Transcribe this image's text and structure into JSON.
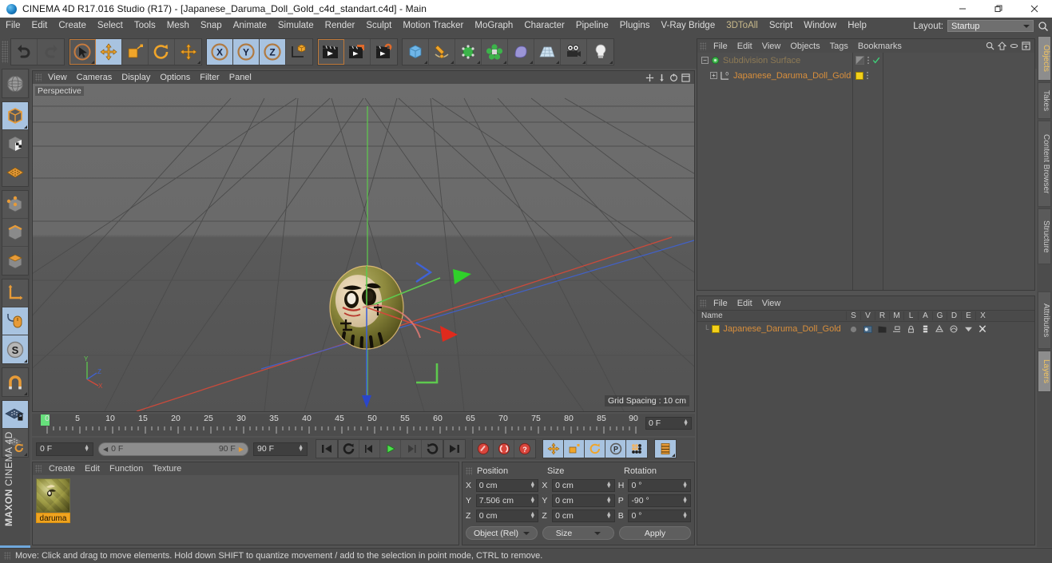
{
  "window": {
    "title": "CINEMA 4D R17.016 Studio (R17) - [Japanese_Daruma_Doll_Gold_c4d_standart.c4d] - Main",
    "app_icon": "cinema4d-logo-icon",
    "minimize": "─",
    "maximize": "❐",
    "close": "×"
  },
  "menubar": {
    "items": [
      {
        "label": "File"
      },
      {
        "label": "Edit"
      },
      {
        "label": "Create"
      },
      {
        "label": "Select"
      },
      {
        "label": "Tools"
      },
      {
        "label": "Mesh"
      },
      {
        "label": "Snap"
      },
      {
        "label": "Animate"
      },
      {
        "label": "Simulate"
      },
      {
        "label": "Render"
      },
      {
        "label": "Sculpt"
      },
      {
        "label": "Motion Tracker"
      },
      {
        "label": "MoGraph"
      },
      {
        "label": "Character"
      },
      {
        "label": "Pipeline"
      },
      {
        "label": "Plugins"
      },
      {
        "label": "V-Ray Bridge"
      },
      {
        "label": "3DToAll"
      },
      {
        "label": "Script"
      },
      {
        "label": "Window"
      },
      {
        "label": "Help"
      }
    ],
    "layout_label": "Layout:",
    "layout_value": "Startup",
    "search_icon": "magnifier-icon"
  },
  "toolbar": {
    "groups": [
      {
        "buttons": [
          {
            "name": "undo-button",
            "icon": "undo-arrow-icon",
            "state": "normal"
          },
          {
            "name": "redo-button",
            "icon": "redo-arrow-icon",
            "state": "disabled"
          }
        ]
      },
      {
        "buttons": [
          {
            "name": "live-selection-tool",
            "icon": "arrow-cursor-circle-icon",
            "state": "outlined"
          },
          {
            "name": "move-tool",
            "icon": "move-cross-arrows-icon",
            "state": "active"
          },
          {
            "name": "scale-tool",
            "icon": "scale-box-icon",
            "state": "normal"
          },
          {
            "name": "rotate-tool",
            "icon": "rotate-circle-arrow-icon",
            "state": "normal"
          },
          {
            "name": "move-axis-tool",
            "icon": "move-cross-arrows-icon",
            "state": "normal"
          }
        ]
      },
      {
        "buttons": [
          {
            "name": "x-axis-lock-button",
            "icon": "x-axis-icon",
            "state": "active",
            "label": "X"
          },
          {
            "name": "y-axis-lock-button",
            "icon": "y-axis-icon",
            "state": "active",
            "label": "Y"
          },
          {
            "name": "z-axis-lock-button",
            "icon": "z-axis-icon",
            "state": "active",
            "label": "Z"
          },
          {
            "name": "world-object-coordinate-button",
            "icon": "world-axis-cube-icon",
            "state": "normal"
          }
        ]
      },
      {
        "buttons": [
          {
            "name": "render-view-button",
            "icon": "clapperboard-icon",
            "state": "outlined"
          },
          {
            "name": "render-to-picture-viewer-button",
            "icon": "clapperboard-picture-icon",
            "state": "normal"
          },
          {
            "name": "render-settings-button",
            "icon": "clapperboard-gear-icon",
            "state": "normal"
          }
        ]
      },
      {
        "buttons": [
          {
            "name": "add-cube-object-button",
            "icon": "blue-cube-icon",
            "state": "normal"
          },
          {
            "name": "add-spline-button",
            "icon": "pen-spline-icon",
            "state": "normal"
          },
          {
            "name": "add-generator-button",
            "icon": "green-cube-icon",
            "state": "normal"
          },
          {
            "name": "add-array-button",
            "icon": "green-cluster-icon",
            "state": "normal"
          },
          {
            "name": "add-deformer-button",
            "icon": "purple-bend-icon",
            "state": "normal"
          },
          {
            "name": "add-scene-environment-button",
            "icon": "floor-grid-icon",
            "state": "normal"
          },
          {
            "name": "add-camera-button",
            "icon": "camera-icon",
            "state": "normal"
          },
          {
            "name": "add-light-button",
            "icon": "lightbulb-icon",
            "state": "normal"
          }
        ]
      }
    ]
  },
  "leftbar": {
    "groups": [
      {
        "buttons": [
          {
            "name": "make-editable-button",
            "icon": "sphere-wireframe-icon",
            "state": "normal"
          }
        ]
      },
      {
        "buttons": [
          {
            "name": "model-mode-button",
            "icon": "orange-outline-cube-icon",
            "state": "active"
          },
          {
            "name": "texture-mode-button",
            "icon": "checker-cube-icon",
            "state": "normal"
          },
          {
            "name": "workplane-mode-button",
            "icon": "orange-grid-plane-icon",
            "state": "normal"
          }
        ]
      },
      {
        "buttons": [
          {
            "name": "point-mode-button",
            "icon": "cube-points-icon",
            "state": "normal"
          },
          {
            "name": "edge-mode-button",
            "icon": "cube-edge-icon",
            "state": "normal"
          },
          {
            "name": "polygon-mode-button",
            "icon": "cube-polygon-icon",
            "state": "normal"
          }
        ]
      },
      {
        "buttons": [
          {
            "name": "object-axis-mode-button",
            "icon": "axis-corner-icon",
            "state": "normal"
          },
          {
            "name": "enable-axis-modification-button",
            "icon": "mouse-axis-icon",
            "state": "active"
          },
          {
            "name": "soft-selection-button",
            "icon": "s-circle-icon",
            "state": "active"
          }
        ]
      },
      {
        "buttons": [
          {
            "name": "enable-snapping-button",
            "icon": "magnet-icon",
            "state": "normal"
          }
        ]
      },
      {
        "buttons": [
          {
            "name": "lock-workplane-button",
            "icon": "grid-lock-icon",
            "state": "active"
          },
          {
            "name": "planar-workplane-button",
            "icon": "grid-rotate-icon",
            "state": "normal"
          }
        ]
      }
    ],
    "brand_line1": "MAXON",
    "brand_line2": "CINEMA 4D"
  },
  "viewport": {
    "menus": [
      {
        "label": "View"
      },
      {
        "label": "Cameras"
      },
      {
        "label": "Display"
      },
      {
        "label": "Options"
      },
      {
        "label": "Filter"
      },
      {
        "label": "Panel"
      }
    ],
    "corner_icons": [
      "pan-icon",
      "dolly-icon",
      "orbit-icon",
      "maximize-view-icon"
    ],
    "label": "Perspective",
    "grid_spacing": "Grid Spacing : 10 cm",
    "mini_axis": [
      "Y",
      "Z",
      "X"
    ],
    "object_name": "Japanese Daruma Doll"
  },
  "timeline": {
    "ticks": [
      "0",
      "5",
      "10",
      "15",
      "20",
      "25",
      "30",
      "35",
      "40",
      "45",
      "50",
      "55",
      "60",
      "65",
      "70",
      "75",
      "80",
      "85",
      "90"
    ],
    "current_frame_field": "0 F",
    "start_frame": "0 F",
    "range_start": "0 F",
    "range_end": "90 F",
    "end_frame": "90 F"
  },
  "transport": {
    "buttons": [
      {
        "name": "go-to-start-button",
        "icon": "skip-start-icon"
      },
      {
        "name": "go-to-previous-key-button",
        "icon": "loop-back-icon"
      },
      {
        "name": "go-back-one-frame-button",
        "icon": "step-back-icon"
      },
      {
        "name": "play-forwards-button",
        "icon": "play-icon"
      },
      {
        "name": "go-forward-one-frame-button",
        "icon": "step-forward-icon"
      },
      {
        "name": "go-to-next-key-button",
        "icon": "loop-forward-icon"
      },
      {
        "name": "go-to-end-button",
        "icon": "skip-end-icon"
      },
      {
        "name": "record-active-objects-button",
        "icon": "record-key-icon"
      },
      {
        "name": "autokeying-button",
        "icon": "autokey-icon"
      },
      {
        "name": "keyframe-selection-button",
        "icon": "question-key-icon"
      },
      {
        "name": "position-key-button",
        "icon": "position-key-icon",
        "state": "active"
      },
      {
        "name": "scale-key-button",
        "icon": "scale-key-icon",
        "state": "active"
      },
      {
        "name": "rotation-key-button",
        "icon": "rotation-key-icon",
        "state": "active"
      },
      {
        "name": "parameter-key-button",
        "icon": "p-key-icon",
        "state": "active"
      },
      {
        "name": "point-level-animation-button",
        "icon": "pla-dots-icon",
        "state": "active"
      },
      {
        "name": "timeline-toggle-button",
        "icon": "timeline-strip-icon",
        "state": "active"
      }
    ]
  },
  "material_manager": {
    "menus": [
      {
        "label": "Create"
      },
      {
        "label": "Edit"
      },
      {
        "label": "Function"
      },
      {
        "label": "Texture"
      }
    ],
    "materials": [
      {
        "name": "daruma",
        "swatch": "gold-sphere-preview"
      }
    ]
  },
  "coordinates": {
    "headers": [
      "Position",
      "Size",
      "Rotation"
    ],
    "rows": [
      {
        "pos_axis": "X",
        "pos_value": "0 cm",
        "size_axis": "X",
        "size_value": "0 cm",
        "rot_axis": "H",
        "rot_value": "0 °"
      },
      {
        "pos_axis": "Y",
        "pos_value": "7.506 cm",
        "size_axis": "Y",
        "size_value": "0 cm",
        "rot_axis": "P",
        "rot_value": "-90 °"
      },
      {
        "pos_axis": "Z",
        "pos_value": "0 cm",
        "size_axis": "Z",
        "size_value": "0 cm",
        "rot_axis": "B",
        "rot_value": "0 °"
      }
    ],
    "mode_dropdown": "Object (Rel)",
    "size_dropdown": "Size",
    "apply_button": "Apply"
  },
  "object_manager": {
    "menus": [
      {
        "label": "File"
      },
      {
        "label": "Edit"
      },
      {
        "label": "View"
      },
      {
        "label": "Objects"
      },
      {
        "label": "Tags"
      },
      {
        "label": "Bookmarks"
      }
    ],
    "tools": [
      "search-icon",
      "home-icon",
      "link-icon",
      "expand-icon"
    ],
    "items": [
      {
        "label": "Subdivision Surface",
        "icon": "subdivision-surface-icon",
        "indent": 0,
        "dimmed": true,
        "tags": [
          "phong-tag-icon",
          "dots-icon",
          "check-icon"
        ]
      },
      {
        "label": "Japanese_Daruma_Doll_Gold",
        "icon": "polygon-object-icon",
        "indent": 1,
        "dimmed": false,
        "tags": [
          "material-tag-yellow",
          "dots-icon"
        ]
      }
    ]
  },
  "attribute_manager": {
    "menus": [
      {
        "label": "File"
      },
      {
        "label": "Edit"
      },
      {
        "label": "View"
      }
    ],
    "name_header": "Name",
    "columns": [
      "S",
      "V",
      "R",
      "M",
      "L",
      "A",
      "G",
      "D",
      "E",
      "X"
    ],
    "rows": [
      {
        "name": "Japanese_Daruma_Doll_Gold",
        "swatch": "yellow-layer-swatch"
      }
    ]
  },
  "right_tabs": {
    "top": [
      {
        "label": "Objects",
        "active": true
      },
      {
        "label": "Takes",
        "active": false
      },
      {
        "label": "Content Browser",
        "active": false
      },
      {
        "label": "Structure",
        "active": false
      }
    ],
    "bottom": [
      {
        "label": "Attributes",
        "active": false
      },
      {
        "label": "Layers",
        "active": true
      }
    ]
  },
  "statusbar": {
    "text": "Move: Click and drag to move elements. Hold down SHIFT to quantize movement / add to the selection in point mode, CTRL to remove."
  },
  "colors": {
    "chrome": "#4c4c4c",
    "panel": "#545454",
    "accent_orange": "#d98f3c",
    "active_blue": "#a8c3e0",
    "axis_x": "#d14a3a",
    "axis_y": "#5ec94e",
    "axis_z": "#3f62d6",
    "material_yellow": "#f3d01a"
  }
}
